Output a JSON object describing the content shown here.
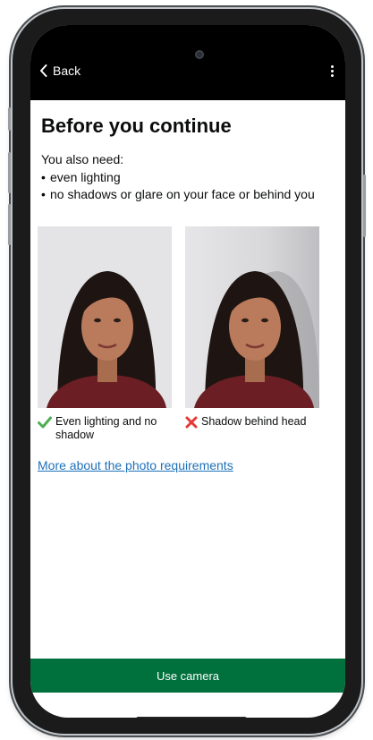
{
  "nav": {
    "back_label": "Back"
  },
  "page": {
    "title": "Before you continue",
    "intro": "You also need:",
    "requirements": [
      "even lighting",
      "no shadows or glare on your face or behind you"
    ]
  },
  "examples": [
    {
      "caption": "Even lighting and no shadow",
      "status": "good",
      "status_icon": "check-icon"
    },
    {
      "caption": "Shadow behind head",
      "status": "bad",
      "status_icon": "cross-icon"
    }
  ],
  "link": {
    "label": "More about the photo requirements"
  },
  "cta": {
    "label": "Use camera"
  },
  "colors": {
    "primary_button": "#00703c",
    "link": "#1d70b8",
    "check": "#4caf50",
    "cross": "#e53935",
    "text": "#0b0c0c"
  }
}
